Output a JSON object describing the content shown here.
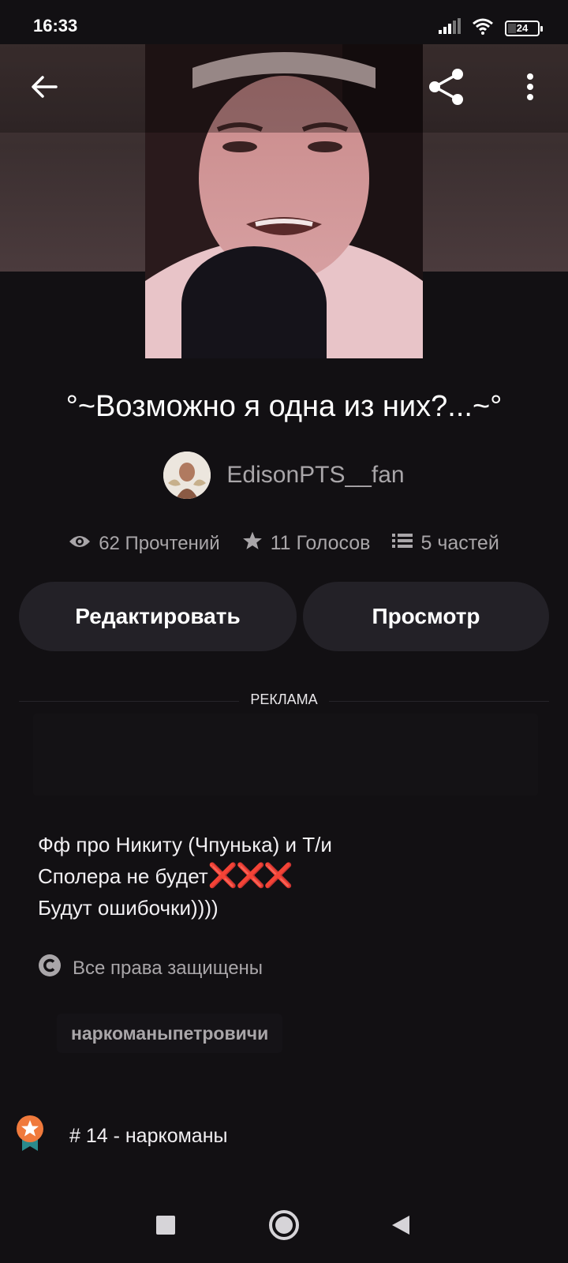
{
  "status_bar": {
    "time": "16:33",
    "battery": "24"
  },
  "toolbar": {
    "back_icon": "arrow-left-icon",
    "share_icon": "share-icon",
    "more_icon": "more-vertical-icon"
  },
  "story": {
    "title": "°~Возможно я одна из них?...~°",
    "author": "EdisonPTS__fan",
    "stats": {
      "reads": "62 Прочтений",
      "votes": "11 Голосов",
      "parts": "5 частей"
    }
  },
  "actions": {
    "edit_label": "Редактировать",
    "view_label": "Просмотр"
  },
  "ad": {
    "label": "РЕКЛАМА"
  },
  "description": {
    "line1": "Фф про Никиту (Чпунька) и Т/и",
    "line2": "Сполера  не будет",
    "line2_marks": "❌❌❌",
    "line3": "Будут ошибочки))))"
  },
  "copyright": {
    "text": "Все права защищены"
  },
  "tags": [
    "наркоманыпетровичи"
  ],
  "ranking": {
    "text": "# 14 - наркоманы"
  },
  "colors": {
    "background": "#121013",
    "button_bg": "#232127",
    "muted_text": "#a9a6a9",
    "badge_orange": "#f07a3c",
    "badge_teal": "#2a8a8c"
  }
}
